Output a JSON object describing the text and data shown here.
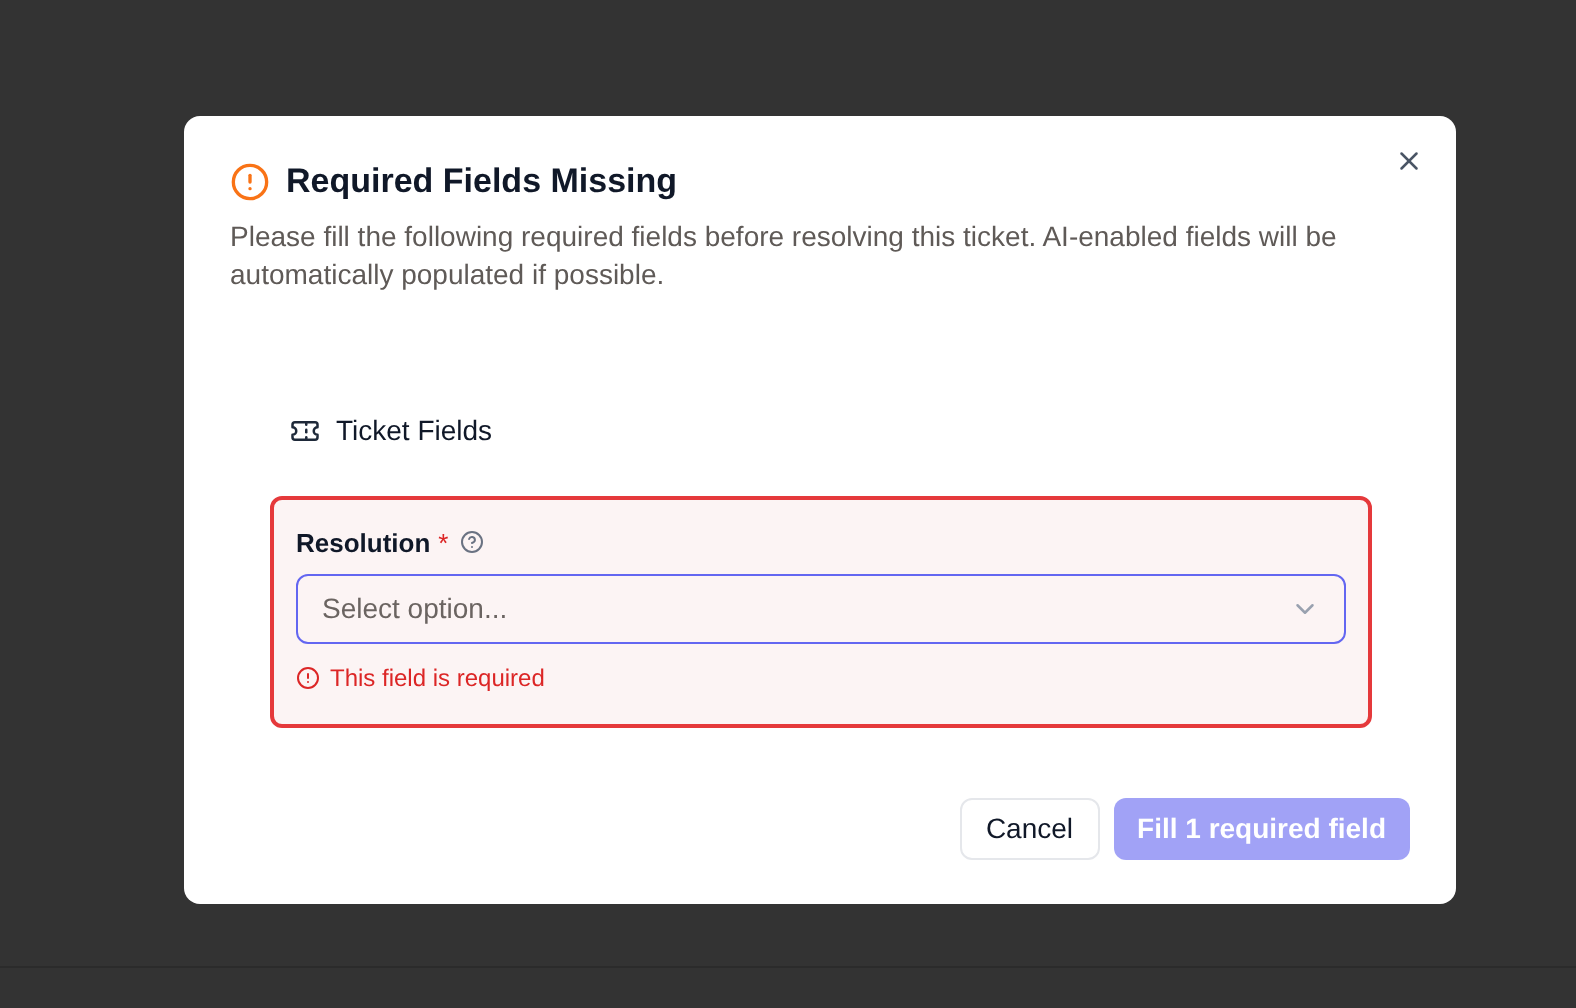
{
  "dialog": {
    "title": "Required Fields Missing",
    "description": "Please fill the following required fields before resolving this ticket. AI-enabled fields will be automatically populated if possible.",
    "section": {
      "title": "Ticket Fields",
      "fields": [
        {
          "label": "Resolution",
          "required_mark": "*",
          "placeholder": "Select option...",
          "error": "This field is required"
        }
      ]
    },
    "buttons": [
      {
        "label": "Cancel",
        "kind": "secondary",
        "disabled": false
      },
      {
        "label": "Fill 1 required field",
        "kind": "primary",
        "disabled": true
      }
    ]
  }
}
